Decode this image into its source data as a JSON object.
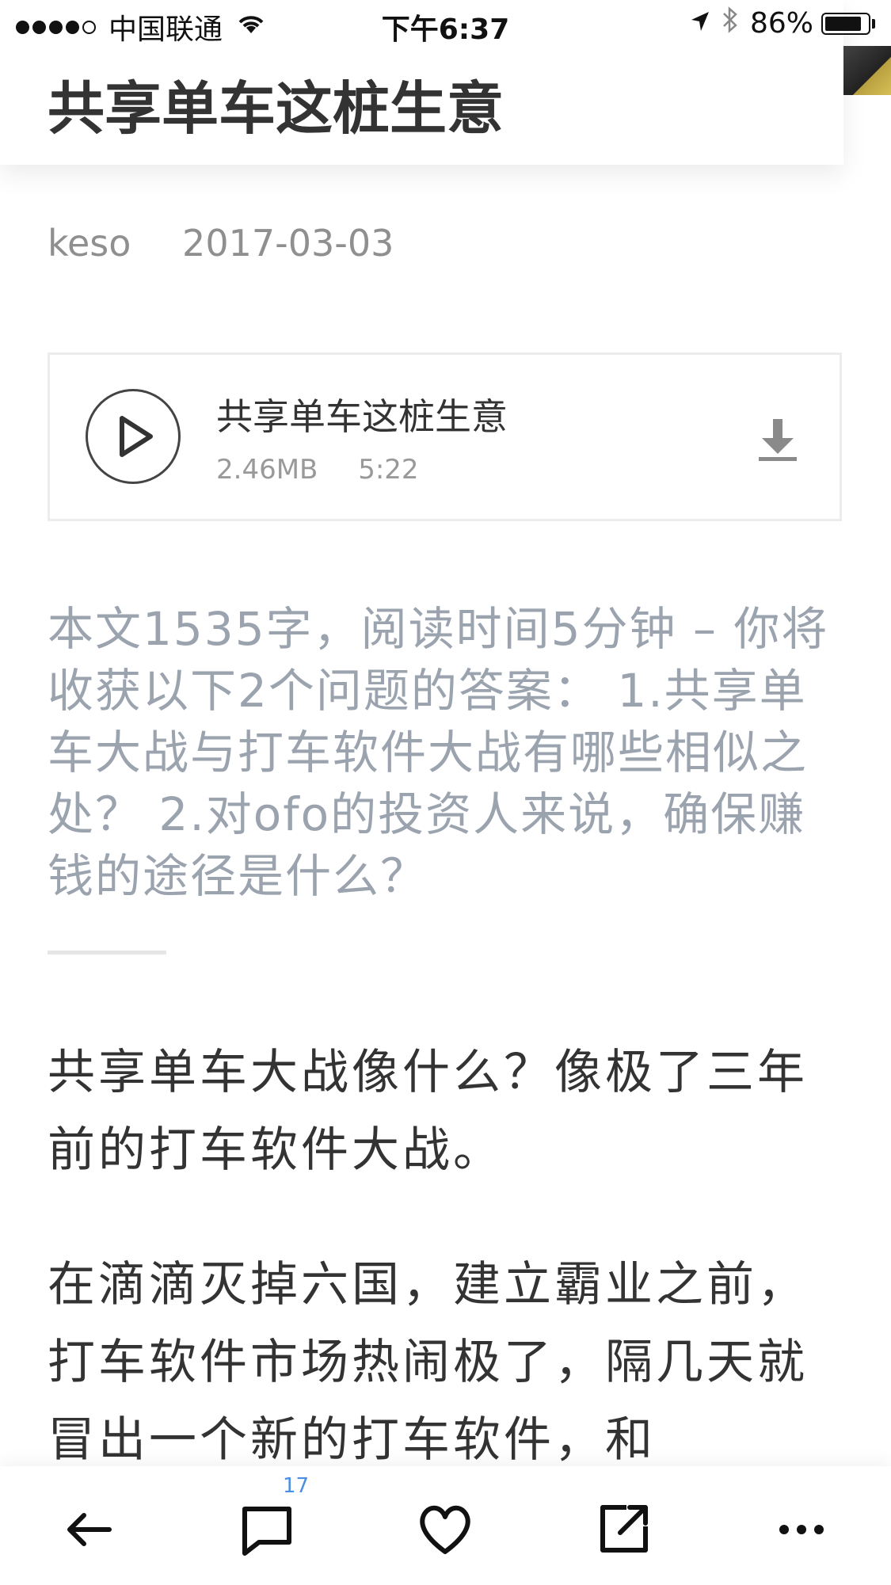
{
  "status_bar": {
    "carrier": "中国联通",
    "time": "下午6:37",
    "battery": "86%",
    "battery_level": 0.86
  },
  "article": {
    "title": "共享单车这桩生意",
    "author": "keso",
    "date": "2017-03-03"
  },
  "audio": {
    "title": "共享单车这桩生意",
    "size": "2.46MB",
    "duration": "5:22"
  },
  "summary": "本文1535字，阅读时间5分钟 – 你将收获以下2个问题的答案： 1.共享单车大战与打车软件大战有哪些相似之处？ 2.对ofo的投资人来说，确保赚钱的途径是什么？",
  "body": {
    "paragraph1": "共享单车大战像什么？像极了三年前的打车软件大战。",
    "paragraph2": "在滴滴灭掉六国，建立霸业之前，打车软件市场热闹极了，隔几天就冒出一个新的打车软件，和"
  },
  "bottom_bar": {
    "comment_count": "17"
  },
  "icons": {
    "back": "back-arrow-icon",
    "comment": "comment-icon",
    "like": "heart-icon",
    "share": "share-icon",
    "more": "more-icon",
    "play": "play-icon",
    "download": "download-icon"
  }
}
